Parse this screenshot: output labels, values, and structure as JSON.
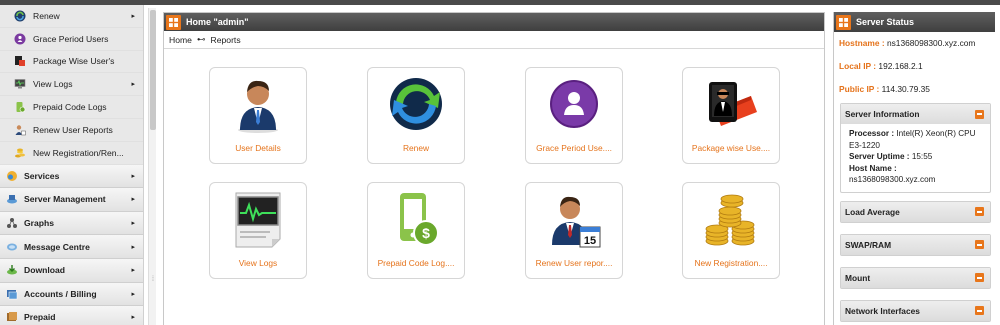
{
  "sidebar": {
    "sub_items": [
      {
        "label": "Renew",
        "icon": "renew-icon",
        "arrow": "▸"
      },
      {
        "label": "Grace Period Users",
        "icon": "user-circle-icon",
        "arrow": ""
      },
      {
        "label": "Package Wise User's",
        "icon": "package-icon",
        "arrow": ""
      },
      {
        "label": "View Logs",
        "icon": "monitor-icon",
        "arrow": "▸"
      },
      {
        "label": "Prepaid Code Logs",
        "icon": "prepaid-icon",
        "arrow": ""
      },
      {
        "label": "Renew User Reports",
        "icon": "user-report-icon",
        "arrow": ""
      },
      {
        "label": "New Registration/Ren...",
        "icon": "coins-icon",
        "arrow": ""
      }
    ],
    "main_items": [
      {
        "label": "Services",
        "icon": "services-icon",
        "arrow": "▸"
      },
      {
        "label": "Server Management",
        "icon": "server-icon",
        "arrow": "▸"
      },
      {
        "label": "Graphs",
        "icon": "graphs-icon",
        "arrow": "▸"
      },
      {
        "label": "Message Centre",
        "icon": "message-icon",
        "arrow": "▸"
      },
      {
        "label": "Download",
        "icon": "download-icon",
        "arrow": "▸"
      },
      {
        "label": "Accounts / Billing",
        "icon": "billing-icon",
        "arrow": "▸"
      },
      {
        "label": "Prepaid",
        "icon": "prepaid-card-icon",
        "arrow": "▸"
      }
    ]
  },
  "main": {
    "title": "Home \"admin\"",
    "breadcrumb": {
      "home": "Home",
      "separator": "⊷",
      "current": "Reports"
    },
    "tiles": [
      {
        "label": "User Details",
        "icon": "user-details-icon"
      },
      {
        "label": "Renew",
        "icon": "renew-arrows-icon"
      },
      {
        "label": "Grace Period Use....",
        "icon": "grace-period-icon"
      },
      {
        "label": "Package wise Use....",
        "icon": "package-wise-icon"
      },
      {
        "label": "View Logs",
        "icon": "view-logs-icon"
      },
      {
        "label": "Prepaid Code Log....",
        "icon": "prepaid-code-icon"
      },
      {
        "label": "Renew User repor....",
        "icon": "renew-user-report-icon"
      },
      {
        "label": "New Registration....",
        "icon": "new-registration-icon"
      }
    ]
  },
  "server_status": {
    "title": "Server Status",
    "hostname_label": "Hostname :",
    "hostname": "ns1368098300.xyz.com",
    "local_ip_label": "Local IP :",
    "local_ip": "192.168.2.1",
    "public_ip_label": "Public IP :",
    "public_ip": "114.30.79.35",
    "server_info": {
      "title": "Server Information",
      "processor_label": "Processor :",
      "processor": "Intel(R) Xeon(R) CPU E3-1220",
      "uptime_label": "Server Uptime :",
      "uptime": "15:55",
      "host_label": "Host Name :",
      "host": "ns1368098300.xyz.com"
    },
    "sections": [
      "Load Average",
      "SWAP/RAM",
      "Mount",
      "Network Interfaces"
    ]
  },
  "colors": {
    "accent": "#e8761b",
    "header": "#4a4a4a",
    "link": "#e5731b"
  }
}
